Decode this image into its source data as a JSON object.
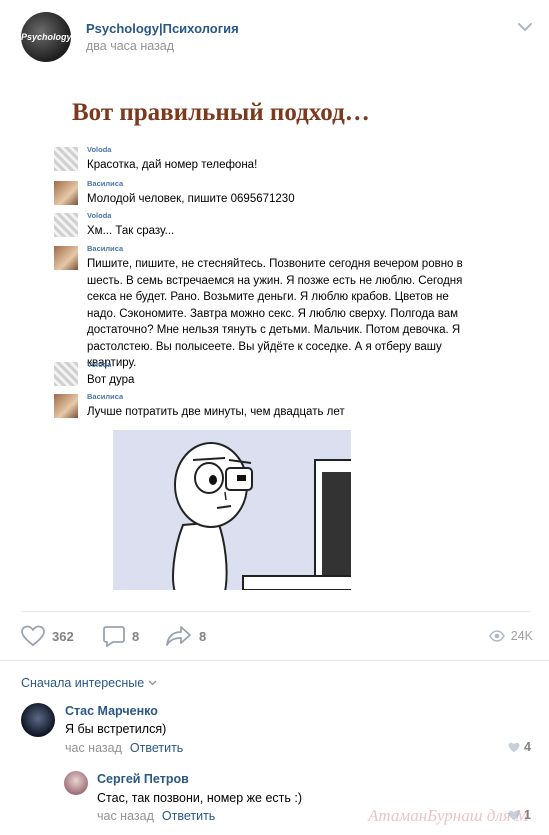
{
  "post": {
    "group_name": "Psychology|Психология",
    "time": "два часа назад",
    "avatar_text": "Psychology"
  },
  "meme": {
    "title": "Вот правильный подход…",
    "messages": [
      {
        "author": "Voloda",
        "text": "Красотка, дай номер телефона!"
      },
      {
        "author": "Василиса",
        "text": "Молодой человек, пишите 0695671230"
      },
      {
        "author": "Voloda",
        "text": "Хм... Так сразу..."
      },
      {
        "author": "Василиса",
        "text": "Пишите, пишите, не стесняйтесь. Позвоните сегодня вечером ровно в шесть. В семь встречаемся на ужин. Я позже есть не люблю. Сегодня секса не будет. Рано. Возьмите деньги. Я люблю крабов. Цветов не надо. Сэкономите. Завтра можно секс. Я люблю сверху. Полгода вам достаточно? Мне нельзя тянуть с детьми. Мальчик. Потом девочка. Я растолстею. Вы полысеете. Вы уйдёте к соседке. А я отберу вашу квартиру."
      },
      {
        "author": "Voloda",
        "text": "Вот дура"
      },
      {
        "author": "Василиса",
        "text": "Лучше потратить две минуты, чем двадцать лет"
      }
    ]
  },
  "actions": {
    "likes": "362",
    "comments": "8",
    "shares": "8",
    "views": "24K"
  },
  "comments_sort": "Сначала интересные",
  "comments": [
    {
      "name": "Стас Марченко",
      "text": "Я бы встретился)",
      "time": "час назад",
      "reply": "Ответить",
      "likes": "4"
    },
    {
      "name": "Сергей Петров",
      "text": "Стас, так позвони, номер же есть :)",
      "time": "час назад",
      "reply": "Ответить",
      "likes": "1"
    }
  ],
  "watermark": "АтаманБурнаш для М",
  "colors": {
    "link": "#2a5885",
    "meme_title": "#7b3a1d",
    "muted": "#939393"
  }
}
